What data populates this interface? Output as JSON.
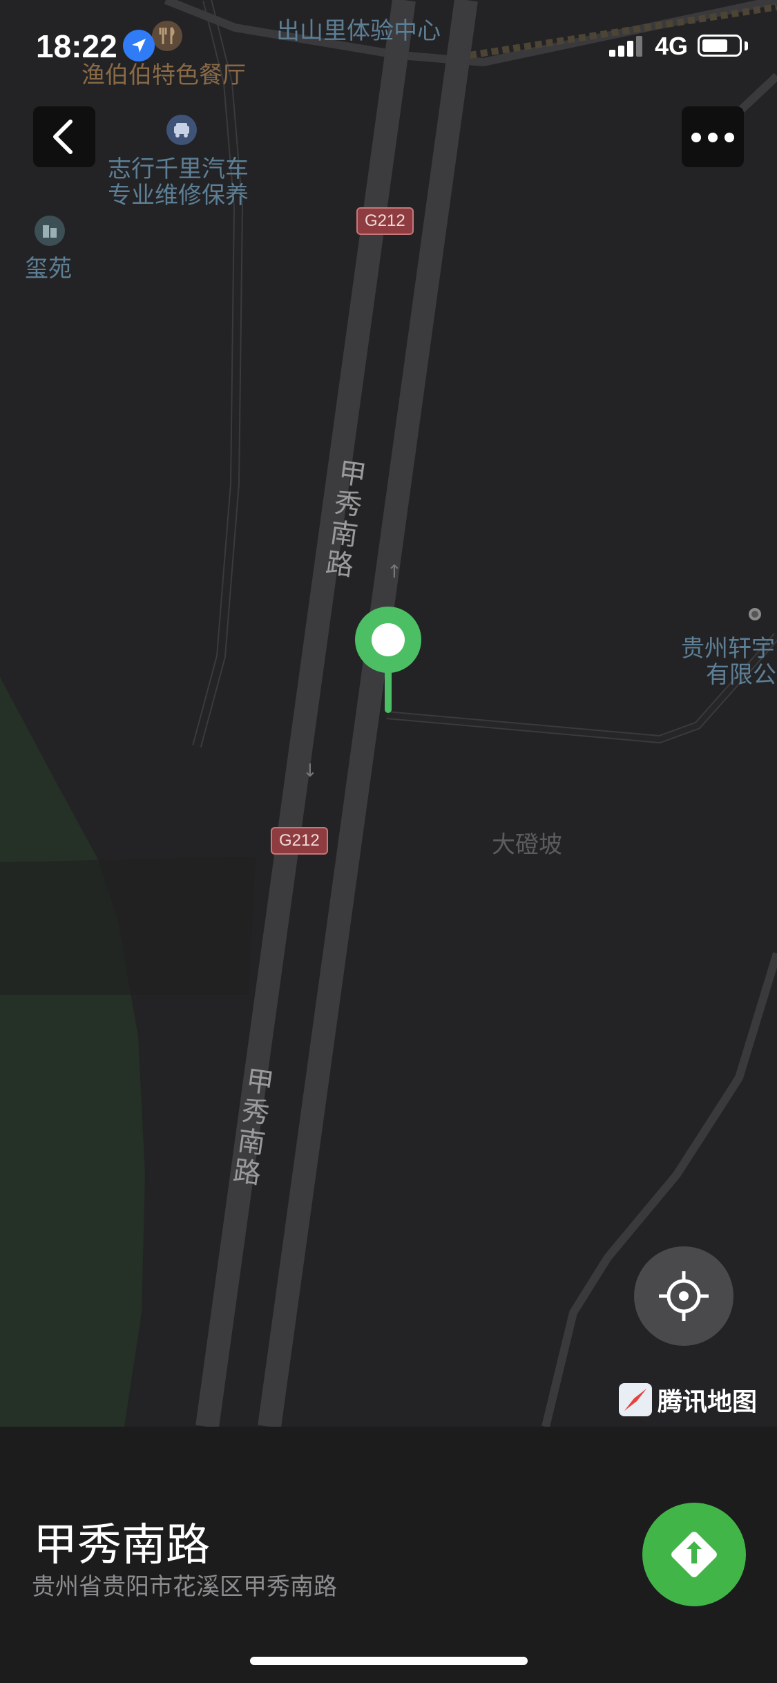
{
  "status_bar": {
    "time": "18:22",
    "network": "4G"
  },
  "map": {
    "pois": [
      {
        "name": "出山里体验中心"
      },
      {
        "name": "渔伯伯特色餐厅"
      },
      {
        "name": "志行千里汽车",
        "name_line2": "专业维修保养"
      },
      {
        "name": "玺苑"
      },
      {
        "name": "贵州轩宇",
        "name_line2": "有限公"
      },
      {
        "name": "大磴坡"
      }
    ],
    "roads": [
      {
        "name": "甲秀南路"
      },
      {
        "name": "甲秀南路"
      }
    ],
    "shields": [
      "G212",
      "G212"
    ],
    "brand": "腾讯地图"
  },
  "place": {
    "title": "甲秀南路",
    "address": "贵州省贵阳市花溪区甲秀南路"
  },
  "icons": {
    "back": "chevron-left-icon",
    "more": "more-dots-icon",
    "locate": "locate-crosshair-icon",
    "route": "route-arrow-icon"
  },
  "colors": {
    "accent": "#41b548",
    "pin": "#4cbf64",
    "map_bg": "#232325"
  }
}
